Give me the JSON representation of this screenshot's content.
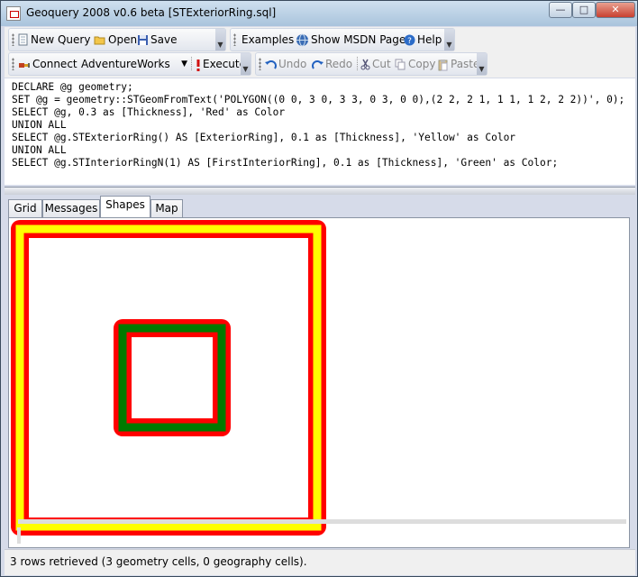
{
  "window": {
    "title": "Geoquery 2008 v0.6 beta [STExteriorRing.sql]"
  },
  "toolbar1": {
    "new_query": "New Query",
    "open": "Open",
    "save": "Save",
    "examples": "Examples",
    "show_msdn": "Show MSDN Page",
    "help": "Help"
  },
  "toolbar2": {
    "connect": "Connect",
    "database": "AdventureWorks",
    "execute": "Execute",
    "undo": "Undo",
    "redo": "Redo",
    "cut": "Cut",
    "copy": "Copy",
    "paste": "Paste"
  },
  "editor": {
    "lines": [
      "DECLARE @g geometry;",
      "SET @g = geometry::STGeomFromText('POLYGON((0 0, 3 0, 3 3, 0 3, 0 0),(2 2, 2 1, 1 1, 1 2, 2 2))', 0);",
      "SELECT @g, 0.3 as [Thickness], 'Red' as Color",
      "UNION ALL",
      "SELECT @g.STExteriorRing() AS [ExteriorRing], 0.1 as [Thickness], 'Yellow' as Color",
      "UNION ALL",
      "SELECT @g.STInteriorRingN(1) AS [FirstInteriorRing], 0.1 as [Thickness], 'Green' as Color;"
    ]
  },
  "tabs": [
    "Grid",
    "Messages",
    "Shapes",
    "Map"
  ],
  "active_tab": "Shapes",
  "shapes": {
    "colors": {
      "red": "#ff0000",
      "yellow": "#ffff00",
      "green": "#007a00"
    }
  },
  "status": {
    "text": "3 rows retrieved (3 geometry cells, 0 geography cells)."
  },
  "icons": [
    "app-icon",
    "new-query-icon",
    "open-folder-icon",
    "save-disk-icon",
    "globe-icon",
    "help-icon",
    "connect-icon",
    "execute-icon",
    "undo-icon",
    "redo-icon",
    "cut-icon",
    "copy-icon",
    "paste-icon"
  ]
}
